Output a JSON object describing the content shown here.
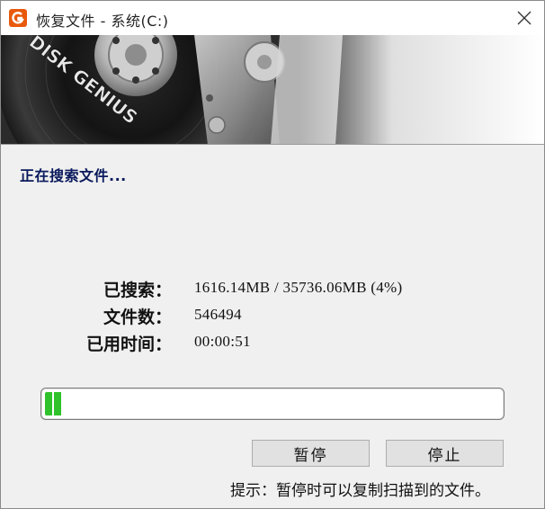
{
  "window": {
    "title": "恢复文件 - 系统(C:)",
    "icon": "diskgenius-app-icon",
    "close_icon": "close-icon"
  },
  "banner": {
    "logo_text": "DISK GENIUS"
  },
  "status": {
    "label": "正在搜索文件..."
  },
  "stats": [
    {
      "label": "已搜索：",
      "value": "1616.14MB / 35736.06MB (4%)"
    },
    {
      "label": "文件数：",
      "value": "546494"
    },
    {
      "label": "已用时间：",
      "value": "00:00:51"
    }
  ],
  "progress": {
    "percent": 4,
    "fill_color": "#2fc22a"
  },
  "buttons": {
    "pause": "暂停",
    "stop": "停止"
  },
  "hint": "提示：暂停时可以复制扫描到的文件。"
}
